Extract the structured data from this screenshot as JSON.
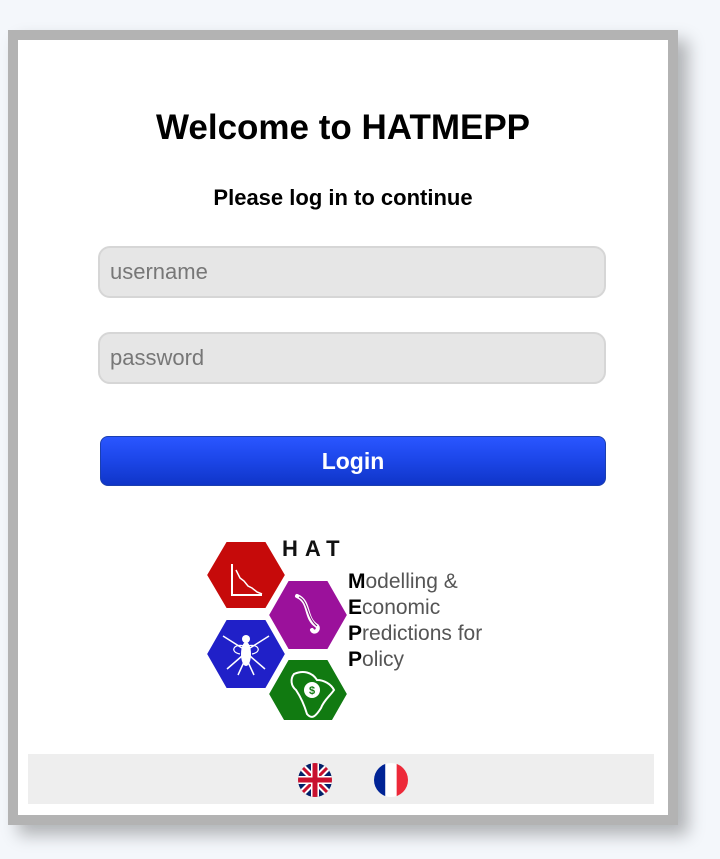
{
  "login": {
    "title": "Welcome to HATMEPP",
    "subtitle": "Please log in to continue",
    "username_placeholder": "username",
    "password_placeholder": "password",
    "login_label": "Login"
  },
  "logo": {
    "hat": "HAT",
    "lines": [
      {
        "lead": "M",
        "rest": "odelling &"
      },
      {
        "lead": "E",
        "rest": "conomic"
      },
      {
        "lead": "P",
        "rest": "redictions for"
      },
      {
        "lead": "P",
        "rest": "olicy"
      }
    ],
    "colors": {
      "red": "#c60a0a",
      "purple": "#9b119b",
      "blue": "#2020c8",
      "green": "#117a11"
    },
    "hexagon_icons": [
      "chart-icon",
      "parasite-icon",
      "tsetse-fly-icon",
      "africa-map-icon"
    ]
  },
  "languages": [
    {
      "name": "uk-flag-icon"
    },
    {
      "name": "france-flag-icon"
    }
  ],
  "colors": {
    "login_button": "#1d47ea",
    "card_border": "#b3b3b3",
    "field_background": "#e6e6e6"
  }
}
